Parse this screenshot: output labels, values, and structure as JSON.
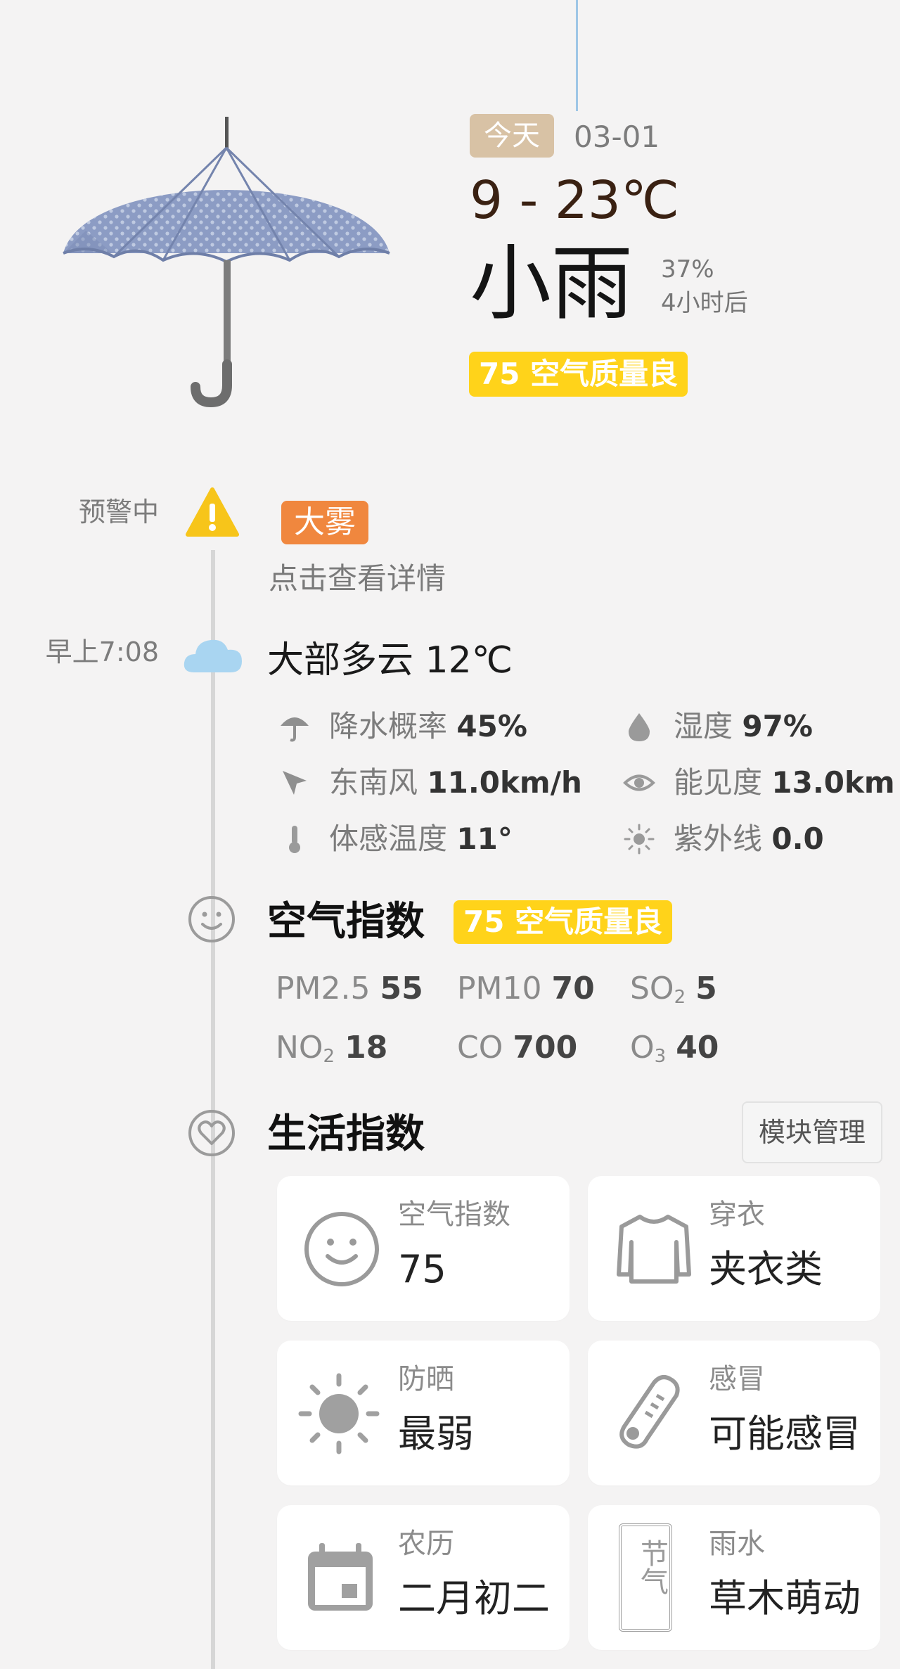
{
  "today": {
    "tag": "今天",
    "date": "03-01",
    "temperature_range": "9 - 23℃",
    "condition": "小雨",
    "precip_prob": "37%",
    "precip_time": "4小时后",
    "aqi_badge": "75 空气质量良"
  },
  "warning": {
    "left_label": "预警中",
    "tag": "大雾",
    "detail_link": "点击查看详情"
  },
  "observation": {
    "time": "早上7:08",
    "summary": "大部多云 12℃",
    "stats": {
      "precip_label": "降水概率",
      "precip_value": "45%",
      "humidity_label": "湿度",
      "humidity_value": "97%",
      "wind_label": "东南风",
      "wind_value": "11.0km/h",
      "visibility_label": "能见度",
      "visibility_value": "13.0km",
      "feels_label": "体感温度",
      "feels_value": "11°",
      "uv_label": "紫外线",
      "uv_value": "0.0"
    }
  },
  "air": {
    "title": "空气指数",
    "badge": "75 空气质量良",
    "pollutants": {
      "pm25_label": "PM2.5",
      "pm25_value": "55",
      "pm10_label": "PM10",
      "pm10_value": "70",
      "so2_label": "SO",
      "so2_sub": "2",
      "so2_value": "5",
      "no2_label": "NO",
      "no2_sub": "2",
      "no2_value": "18",
      "co_label": "CO",
      "co_value": "700",
      "o3_label": "O",
      "o3_sub": "3",
      "o3_value": "40"
    }
  },
  "life": {
    "title": "生活指数",
    "module_button": "模块管理",
    "cards": [
      {
        "title": "空气指数",
        "value": "75",
        "icon": "smiley-icon"
      },
      {
        "title": "穿衣",
        "value": "夹衣类",
        "icon": "sweater-icon"
      },
      {
        "title": "防晒",
        "value": "最弱",
        "icon": "sun-icon"
      },
      {
        "title": "感冒",
        "value": "可能感冒",
        "icon": "thermometer-icon"
      },
      {
        "title": "农历",
        "value": "二月初二",
        "icon": "calendar-icon"
      },
      {
        "title": "雨水",
        "value": "草木萌动",
        "icon": "solar-term-icon",
        "icon_text": "节气"
      }
    ]
  },
  "colors": {
    "aqi_yellow": "#ffd31a",
    "warning_orange": "#f0873e",
    "today_tag": "#d8c2a5",
    "temp_brown": "#3a2112"
  }
}
